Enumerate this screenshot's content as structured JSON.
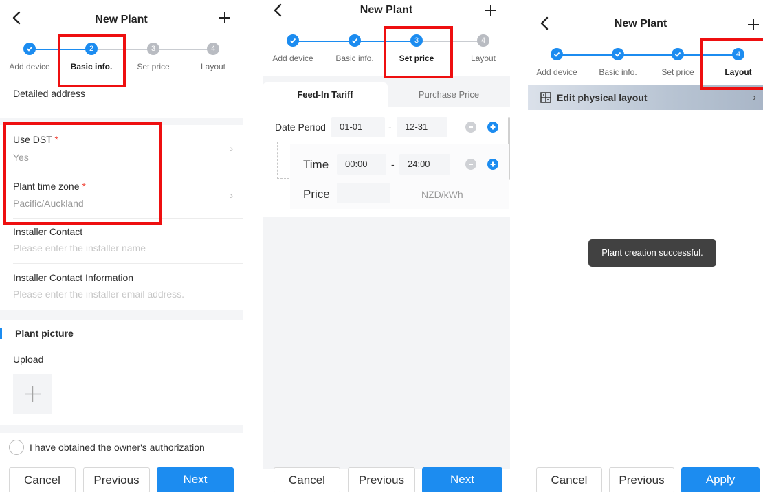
{
  "header": {
    "title": "New Plant"
  },
  "steps": [
    "Add device",
    "Basic info.",
    "Set price",
    "Layout"
  ],
  "step_numbers": [
    "2",
    "3",
    "4"
  ],
  "panel1": {
    "detailed_address_label": "Detailed address",
    "use_dst_label": "Use DST",
    "use_dst_value": "Yes",
    "time_zone_label": "Plant time zone",
    "time_zone_value": "Pacific/Auckland",
    "required_mark": "*",
    "installer_contact_label": "Installer Contact",
    "installer_contact_placeholder": "Please enter the installer name",
    "installer_info_label": "Installer Contact Information",
    "installer_info_placeholder": "Please enter the installer email address.",
    "picture_section_title": "Plant picture",
    "upload_label": "Upload",
    "authorization_text": "I have obtained the owner's authorization"
  },
  "panel2": {
    "tab_feed_in": "Feed-In Tariff",
    "tab_purchase": "Purchase Price",
    "date_period_label": "Date Period",
    "date_start": "01-01",
    "date_end": "12-31",
    "dash": "-",
    "time_label": "Time",
    "time_start": "00:00",
    "time_end": "24:00",
    "price_label": "Price",
    "price_value": "",
    "price_unit": "NZD/kWh"
  },
  "panel3": {
    "edit_layout_label": "Edit physical layout",
    "toast": "Plant creation successful."
  },
  "buttons": {
    "cancel": "Cancel",
    "previous": "Previous",
    "next": "Next",
    "apply": "Apply"
  },
  "icons": [
    "back-arrow-icon",
    "plus-icon",
    "check-icon",
    "chevron-right-icon",
    "upload-plus-icon",
    "minus-circle-icon",
    "add-circle-icon",
    "layout-grid-icon"
  ],
  "colors": {
    "accent": "#1c8cf0",
    "highlight_box": "#ee0f10",
    "required": "#f0463a"
  }
}
